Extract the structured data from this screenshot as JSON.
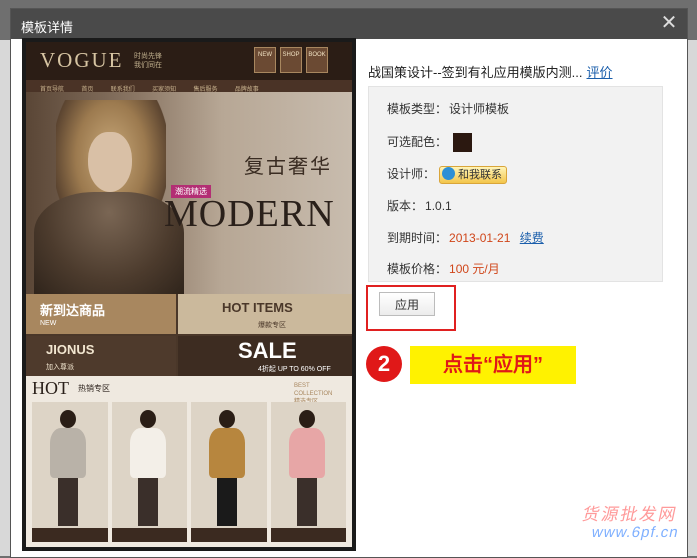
{
  "dialog": {
    "title": "模板详情",
    "close_glyph": "✕"
  },
  "preview": {
    "logo": "VOGUE",
    "logo_sub": "时尚先锋 我们同在",
    "tags": [
      "NEW",
      "SHOP",
      "BOOK"
    ],
    "nav": [
      "首页导航",
      "首页",
      "联系我们",
      "买家须知",
      "售后服务",
      "品牌故事"
    ],
    "hero_cn": "复古奢华",
    "hero_badge": "潮流精选",
    "hero_en": "MODERN",
    "cells": {
      "c1_big": "新到达商品",
      "c1_small": "NEW",
      "c2_big": "HOT ITEMS",
      "c2_small": "爆款专区",
      "c3_big": "JIONUS",
      "c3_small": "加入尊派",
      "c4_big": "SALE",
      "c4_small": "4折起 UP TO 60% OFF"
    },
    "hot_title": "HOT",
    "hot_sub": "热销专区",
    "hot_best": "BEST COLLECTION 精选专区"
  },
  "info": {
    "template_name": "战国策设计--签到有礼应用模版内测...",
    "review_link": "评价",
    "type_label": "模板类型：",
    "type_value": "设计师模板",
    "color_label": "可选配色：",
    "color_hex": "#2b1810",
    "designer_label": "设计师：",
    "contact_label": "和我联系",
    "version_label": "版本：",
    "version_value": "1.0.1",
    "expire_label": "到期时间：",
    "expire_value": "2013-01-21",
    "renew_link": "续费",
    "price_label": "模板价格：",
    "price_value": "100 元/月"
  },
  "apply_button": "应用",
  "annotation": {
    "step": "2",
    "note": "点击“应用”"
  },
  "watermark": {
    "cn": "货源批发网",
    "url": "www.6pf.cn"
  }
}
